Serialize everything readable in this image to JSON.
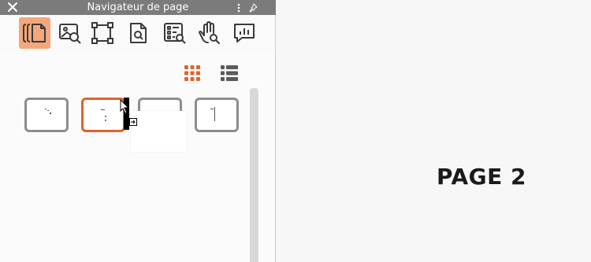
{
  "panel": {
    "title": "Navigateur de page",
    "close_icon": "close-icon",
    "menu_icon": "kebab-menu-icon",
    "pin_icon": "pin-icon"
  },
  "toolbar": {
    "tools": [
      {
        "icon": "pages-icon",
        "active": true
      },
      {
        "icon": "image-search-icon",
        "active": false
      },
      {
        "icon": "selection-frame-icon",
        "active": false
      },
      {
        "icon": "document-search-icon",
        "active": false
      },
      {
        "icon": "list-search-icon",
        "active": false
      },
      {
        "icon": "hand-search-icon",
        "active": false
      },
      {
        "icon": "chart-comment-icon",
        "active": false
      }
    ],
    "accent_color": "#e2622d"
  },
  "view_toggle": {
    "grid_icon": "grid-view-icon",
    "list_icon": "list-view-icon",
    "selected": "grid"
  },
  "thumbnails": [
    {
      "page": 1,
      "selected": false
    },
    {
      "page": 2,
      "selected": true
    },
    {
      "page": 3,
      "selected": false
    },
    {
      "page": 4,
      "selected": false
    }
  ],
  "canvas": {
    "page_label": "PAGE 2"
  }
}
